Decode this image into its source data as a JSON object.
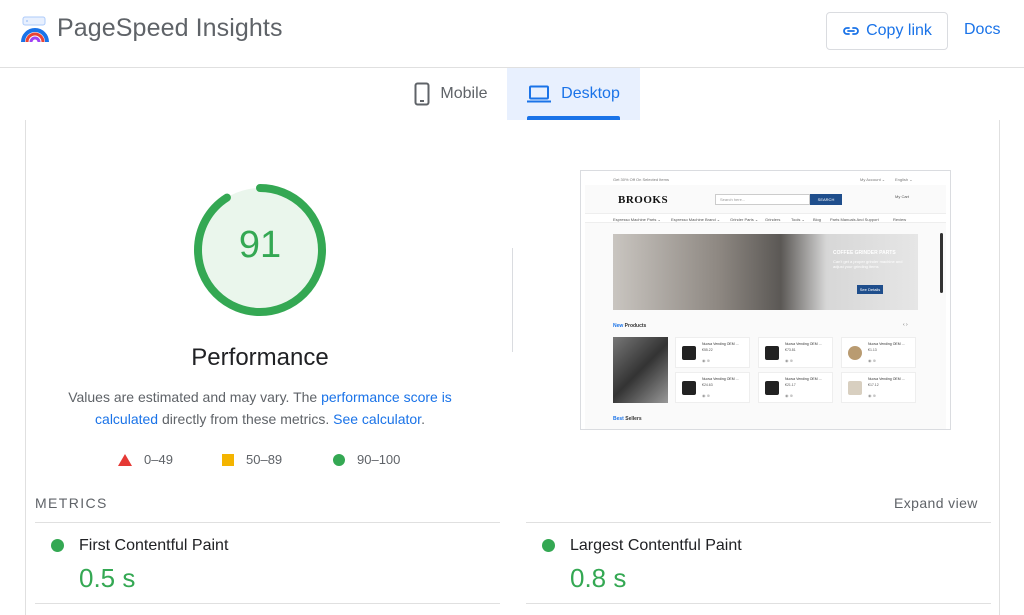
{
  "header": {
    "app_title": "PageSpeed Insights",
    "copy_link_label": "Copy link",
    "docs_label": "Docs"
  },
  "tabs": [
    {
      "label": "Mobile",
      "selected": false
    },
    {
      "label": "Desktop",
      "selected": true
    }
  ],
  "performance": {
    "score": "91",
    "score_fraction": 0.91,
    "title": "Performance",
    "desc_prefix": "Values are estimated and may vary. The ",
    "desc_link1": "performance score is calculated",
    "desc_middle": " directly from these metrics. ",
    "desc_link2": "See calculator",
    "desc_suffix": ".",
    "legend": [
      {
        "range": "0–49",
        "color": "#e53935"
      },
      {
        "range": "50–89",
        "color": "#f4b400"
      },
      {
        "range": "90–100",
        "color": "#34a853"
      }
    ]
  },
  "screenshot": {
    "topbar_left": "Get 30% Off On Selected Items",
    "topbar_account": "My Account ⌄",
    "topbar_lang": "English ⌄",
    "brand": "BROOKS",
    "search_placeholder": "Search here...",
    "search_button": "SEARCH",
    "cart": "My Cart",
    "nav": [
      "Espresso Machine Parts ⌄",
      "Espresso Machine Brand ⌄",
      "Grinder Parts ⌄",
      "Grinders",
      "Tools ⌄",
      "Blog",
      "Parts Manuals And Support",
      "Review"
    ],
    "hero_title": "COFFEE GRINDER PARTS",
    "hero_sub": "Can't get a proper grinder machine and adjust your grinding items",
    "hero_button": "See Details",
    "section_highlight": "New",
    "section_rest": " Products",
    "arrows": "‹  ›",
    "products": [
      {
        "name": "Nuova Vending OEM ...",
        "price": "€55.22"
      },
      {
        "name": "Nuova Vending OEM ...",
        "price": "€73.81"
      },
      {
        "name": "Nuova Vending OEM ...",
        "price": "€1.13"
      },
      {
        "name": "Nuova Vending OEM ...",
        "price": "€24.63"
      },
      {
        "name": "Nuova Vending OEM ...",
        "price": "€21.17"
      },
      {
        "name": "Nuova Vending OEM ...",
        "price": "€17.12"
      }
    ],
    "product_icons": "◉  ⊕",
    "best_highlight": "Best",
    "best_rest": " Sellers"
  },
  "metrics": {
    "section_label": "METRICS",
    "expand_label": "Expand view",
    "items": [
      {
        "name": "First Contentful Paint",
        "value": "0.5 s",
        "color": "#34a853"
      },
      {
        "name": "Largest Contentful Paint",
        "value": "0.8 s",
        "color": "#34a853"
      }
    ]
  },
  "colors": {
    "accent": "#1a73e8",
    "pass": "#34a853",
    "average": "#f4b400",
    "fail": "#e53935"
  }
}
